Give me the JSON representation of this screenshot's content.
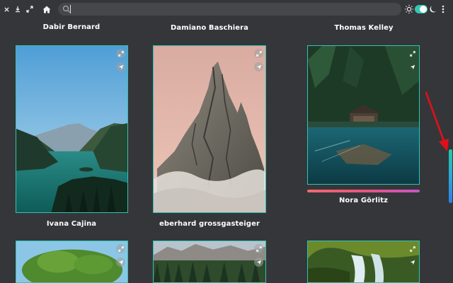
{
  "search": {
    "value": ""
  },
  "artists_top": [
    "Dabir Bernard",
    "Damiano Baschiera",
    "Thomas Kelley"
  ],
  "cards": [
    {
      "artist": "Ivana Cajina",
      "photo": "lake-mountains"
    },
    {
      "artist": "eberhard grossgasteiger",
      "photo": "rocky-peak"
    },
    {
      "artist": "Nora Görlitz",
      "photo": "forest-cabin-lake"
    }
  ],
  "bottom_cards": [
    {
      "photo": "big-tree"
    },
    {
      "photo": "mountain-forest"
    },
    {
      "photo": "waterfall"
    }
  ],
  "colors": {
    "accent": "#2fc4b2",
    "background": "#35363a",
    "annotation_arrow": "#e0101a"
  }
}
